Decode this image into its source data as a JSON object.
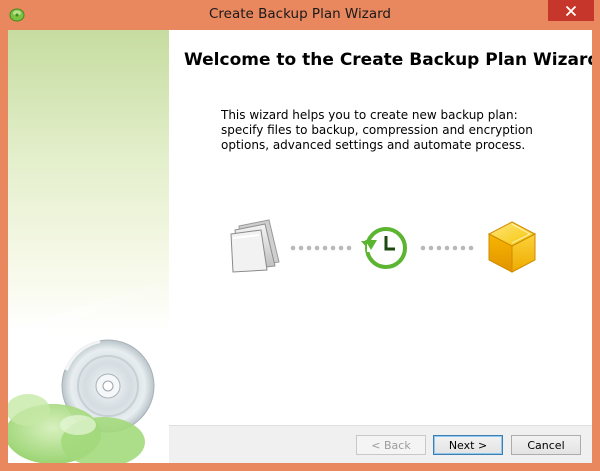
{
  "window": {
    "title": "Create Backup Plan Wizard",
    "close_glyph": "✕"
  },
  "page": {
    "heading": "Welcome to the Create Backup Plan Wizard",
    "description": "This wizard helps you to create new backup plan: specify files to backup, compression and encryption options, advanced settings and automate process."
  },
  "buttons": {
    "back": "< Back",
    "next": "Next >",
    "cancel": "Cancel"
  },
  "icons": {
    "app": "app-leaf-icon",
    "files": "files-icon",
    "schedule": "clock-sync-icon",
    "storage": "storage-cube-icon",
    "disc": "disc-icon"
  },
  "colors": {
    "frame": "#e9875f",
    "close": "#c7362a",
    "accent_green": "#6bbf35",
    "cube_yellow": "#f2b705"
  }
}
